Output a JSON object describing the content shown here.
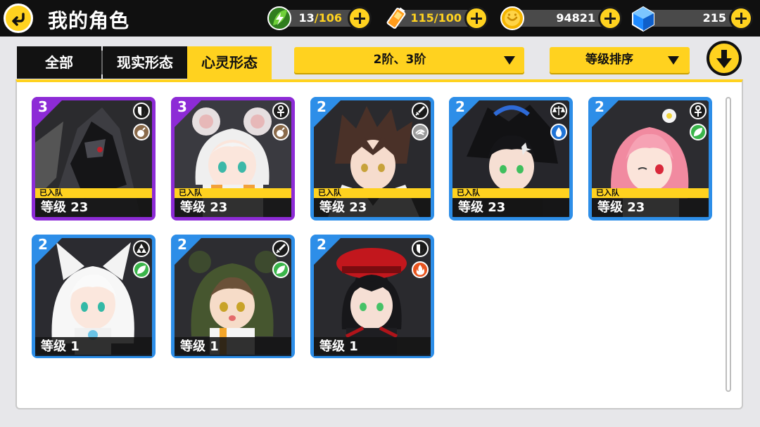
{
  "header": {
    "title": "我的角色",
    "resources": [
      {
        "name": "stamina",
        "icon": "leaf-energy-icon",
        "current": "13",
        "max": "106",
        "separator": "/"
      },
      {
        "name": "battery",
        "icon": "battery-icon",
        "current": "115",
        "max": "100",
        "separator": "/"
      },
      {
        "name": "coins",
        "icon": "coin-icon",
        "amount": "94821"
      },
      {
        "name": "crystals",
        "icon": "blue-crystal-icon",
        "amount": "215"
      }
    ]
  },
  "tabs": [
    {
      "label": "全部",
      "active": false
    },
    {
      "label": "现实形态",
      "active": false
    },
    {
      "label": "心灵形态",
      "active": true
    }
  ],
  "filters": {
    "rank_filter": "2阶、3阶",
    "sort": "等级排序"
  },
  "cards": [
    {
      "rank": "3",
      "frame": "purple",
      "class_icon": "shield-icon",
      "element_icon": "bomb-icon",
      "element_color": "#8a6a4a",
      "in_team": "已入队",
      "level": "等级 23"
    },
    {
      "rank": "3",
      "frame": "purple",
      "class_icon": "ankh-icon",
      "element_icon": "bomb-icon",
      "element_color": "#8a6a4a",
      "in_team": "已入队",
      "level": "等级 23"
    },
    {
      "rank": "2",
      "frame": "blue",
      "class_icon": "sword-icon",
      "element_icon": "wind-icon",
      "element_color": "#9a9a9a",
      "in_team": "已入队",
      "level": "等级 23"
    },
    {
      "rank": "2",
      "frame": "blue",
      "class_icon": "scales-icon",
      "element_icon": "water-drop-icon",
      "element_color": "#1e73d6",
      "in_team": "已入队",
      "level": "等级 23"
    },
    {
      "rank": "2",
      "frame": "blue",
      "class_icon": "ankh-icon",
      "element_icon": "leaf-icon",
      "element_color": "#3ab54a",
      "in_team": "已入队",
      "level": "等级 23"
    },
    {
      "rank": "2",
      "frame": "blue",
      "class_icon": "triforce-icon",
      "element_icon": "leaf-icon",
      "element_color": "#3ab54a",
      "in_team": "",
      "level": "等级 1"
    },
    {
      "rank": "2",
      "frame": "blue",
      "class_icon": "sword-icon",
      "element_icon": "leaf-icon",
      "element_color": "#3ab54a",
      "in_team": "",
      "level": "等级 1"
    },
    {
      "rank": "2",
      "frame": "blue",
      "class_icon": "shield-icon",
      "element_icon": "fire-icon",
      "element_color": "#e8541e",
      "in_team": "",
      "level": "等级 1"
    }
  ],
  "colors": {
    "accent": "#ffd21f",
    "rank3_frame": "#8d2bd6",
    "rank2_frame": "#2d8ee8"
  }
}
